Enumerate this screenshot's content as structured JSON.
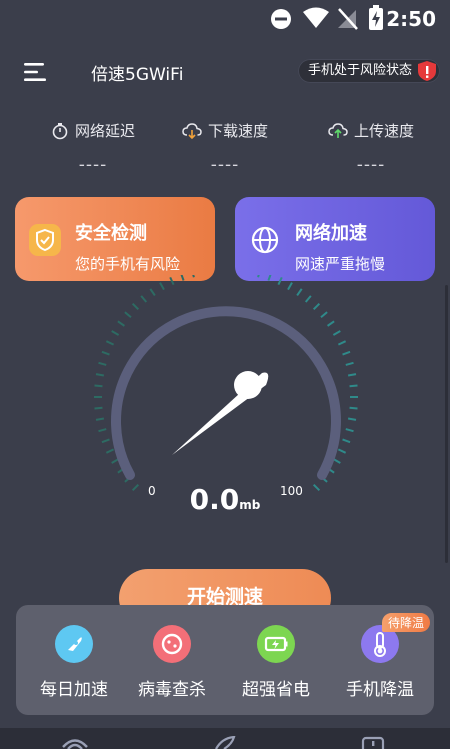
{
  "status_bar": {
    "time": "2:50"
  },
  "header": {
    "title": "倍速5GWiFi",
    "risk_status": "手机处于风险状态"
  },
  "metrics": [
    {
      "label": "网络延迟",
      "value": "----",
      "icon": "stopwatch-icon"
    },
    {
      "label": "下载速度",
      "value": "----",
      "icon": "cloud-download-icon"
    },
    {
      "label": "上传速度",
      "value": "----",
      "icon": "cloud-upload-icon"
    }
  ],
  "cards": {
    "security": {
      "title": "安全检测",
      "subtitle": "您的手机有风险",
      "icon": "shield-icon"
    },
    "boost": {
      "title": "网络加速",
      "subtitle": "网速严重拖慢",
      "icon": "globe-icon"
    }
  },
  "gauge": {
    "min_label": "0",
    "max_label": "100",
    "value": "0.0",
    "unit": "mb"
  },
  "start_button": {
    "label": "开始测速"
  },
  "tools": [
    {
      "label": "每日加速",
      "icon": "rocket-icon",
      "color": "#5ec8f2"
    },
    {
      "label": "病毒查杀",
      "icon": "virus-icon",
      "color": "#f36f78"
    },
    {
      "label": "超强省电",
      "icon": "battery-icon",
      "color": "#7dd651"
    },
    {
      "label": "手机降温",
      "icon": "thermometer-icon",
      "color": "#8d79ef",
      "tag": "待降温"
    }
  ],
  "colors": {
    "background": "#3b3e4b",
    "accent_orange": "#ee8b55",
    "accent_purple": "#6459d8"
  }
}
